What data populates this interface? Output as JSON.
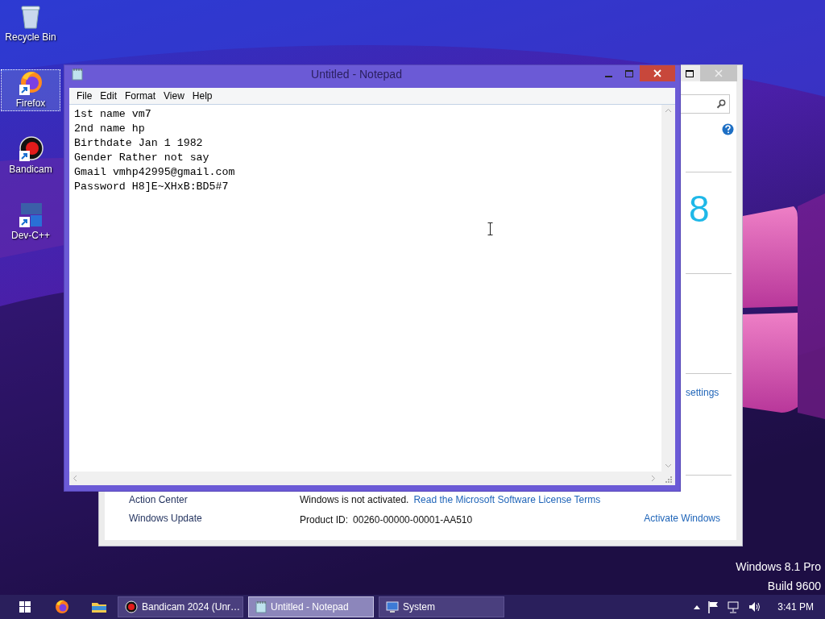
{
  "desktop_icons": [
    {
      "label": "Recycle Bin",
      "kind": "recycle",
      "selected": false
    },
    {
      "label": "Firefox",
      "kind": "browser",
      "selected": true
    },
    {
      "label": "Bandicam",
      "kind": "recorder",
      "selected": false
    },
    {
      "label": "Dev-C++",
      "kind": "ide",
      "selected": false
    }
  ],
  "system_window": {
    "logo_text": "8",
    "settings_link": "settings",
    "sidebar_links": [
      "Action Center",
      "Windows Update"
    ],
    "activation_status": "Windows is not activated.",
    "license_link": "Read the Microsoft Software License Terms",
    "product_id_label": "Product ID:",
    "product_id": "00260-00000-00001-AA510",
    "activate_link": "Activate Windows"
  },
  "notepad": {
    "title": "Untitled - Notepad",
    "menu": [
      "File",
      "Edit",
      "Format",
      "View",
      "Help"
    ],
    "lines": [
      "1st name vm7",
      "2nd name hp",
      "Birthdate Jan 1 1982",
      "Gender Rather not say",
      "Gmail vmhp42995@gmail.com",
      "Password H8]E~XHxB:BD5#7"
    ]
  },
  "edition_info": [
    "Windows 8.1 Pro",
    "Build 9600"
  ],
  "taskbar": {
    "buttons": [
      {
        "label": "Bandicam 2024 (Unr…",
        "kind": "recorder",
        "selected": false
      },
      {
        "label": "Untitled - Notepad",
        "kind": "notepad",
        "selected": true
      },
      {
        "label": "System",
        "kind": "system",
        "selected": false
      }
    ],
    "clock": "3:41 PM"
  }
}
